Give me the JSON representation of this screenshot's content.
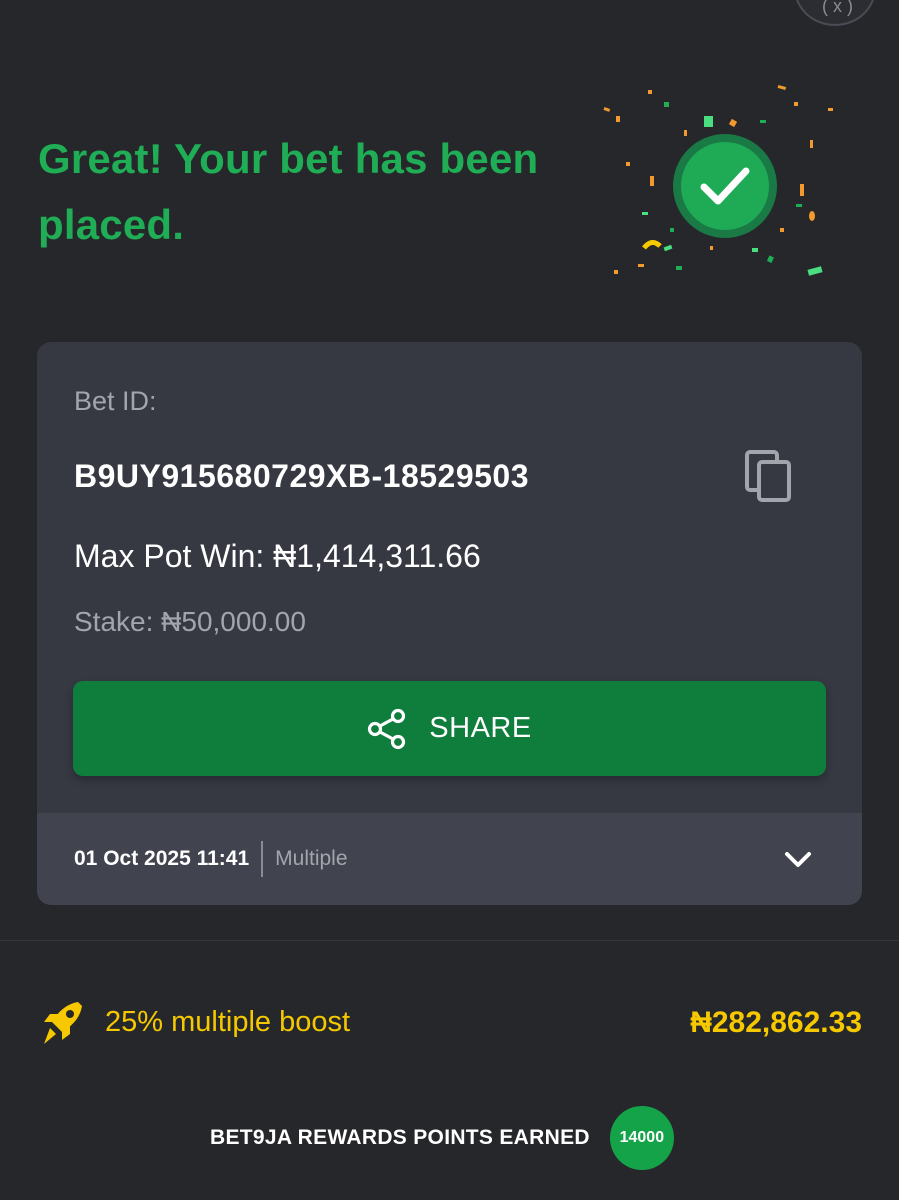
{
  "header": {
    "title": "Great! Your bet has been placed.",
    "close_icon": "close-icon"
  },
  "bet": {
    "id_label": "Bet ID:",
    "id_value": "B9UY915680729XB-18529503",
    "max_pot_win": "Max Pot Win: ₦1,414,311.66",
    "stake": "Stake: ₦50,000.00",
    "share_label": "SHARE",
    "date": "01 Oct 2025 11:41",
    "type": "Multiple"
  },
  "boost": {
    "label": "25% multiple boost",
    "amount": "₦282,862.33"
  },
  "rewards": {
    "label": "BET9JA REWARDS POINTS EARNED",
    "points": "14000"
  },
  "colors": {
    "background": "#26272b",
    "card": "#363842",
    "accent_green": "#1fae56",
    "button_green": "#0f7d3c",
    "boost_yellow": "#f6c800"
  }
}
